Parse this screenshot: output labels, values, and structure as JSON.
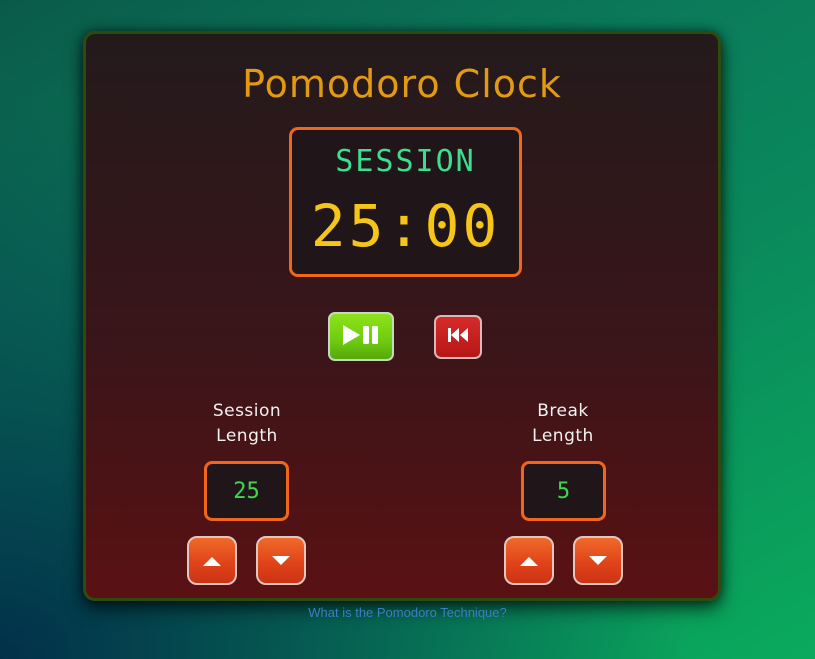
{
  "app": {
    "title": "Pomodoro Clock"
  },
  "timer": {
    "mode": "SESSION",
    "time": "25:00"
  },
  "controls": {
    "play_pause": "play-pause",
    "reset": "reset"
  },
  "session": {
    "label_line1": "Session",
    "label_line2": "Length",
    "value": "25"
  },
  "break": {
    "label_line1": "Break",
    "label_line2": "Length",
    "value": "5"
  },
  "footer": {
    "link_text": "What is the Pomodoro Technique?"
  },
  "colors": {
    "title": "#e19a12",
    "mode_text": "#3ddf8f",
    "time_text": "#f5c518",
    "length_text": "#3ed84f",
    "border_accent": "#f0661a",
    "play_button": "#7ed617",
    "reset_button": "#c81f1f",
    "arrow_button": "#e0441a",
    "link": "#3a7fbf"
  },
  "icons": {
    "play_pause": "play-pause-icon",
    "reset": "skip-back-icon",
    "increment": "triangle-up-icon",
    "decrement": "triangle-down-icon"
  }
}
